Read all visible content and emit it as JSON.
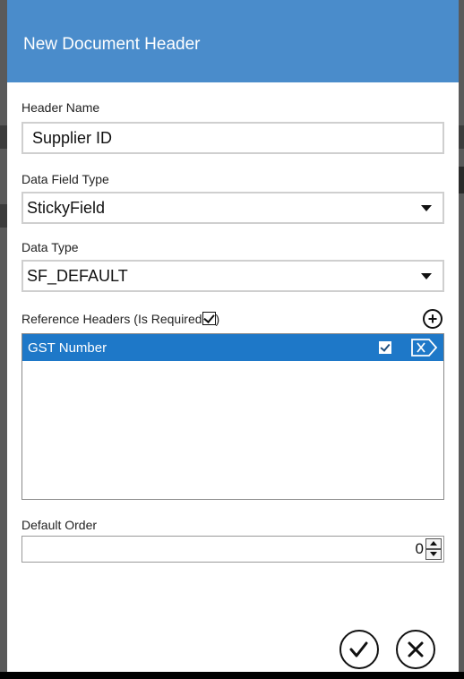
{
  "dialog": {
    "title": "New Document Header"
  },
  "fields": {
    "header_name_label": "Header Name",
    "header_name_value": "Supplier ID",
    "data_field_type_label": "Data Field Type",
    "data_field_type_value": "StickyField",
    "data_type_label": "Data Type",
    "data_type_value": "SF_DEFAULT",
    "reference_headers_label_prefix": "Reference Headers (Is Required",
    "reference_headers_label_suffix": ")",
    "default_order_label": "Default Order",
    "default_order_value": "0"
  },
  "reference_headers": [
    {
      "name": "GST Number",
      "is_required": true,
      "selected": true
    }
  ],
  "icons": {
    "add": "plus-circle-icon",
    "delete": "delete-tag-icon",
    "confirm": "check-circle-icon",
    "cancel": "close-circle-icon",
    "dropdown": "chevron-down-icon"
  },
  "colors": {
    "titlebar": "#4a8ccb",
    "selection": "#1e78c8"
  }
}
